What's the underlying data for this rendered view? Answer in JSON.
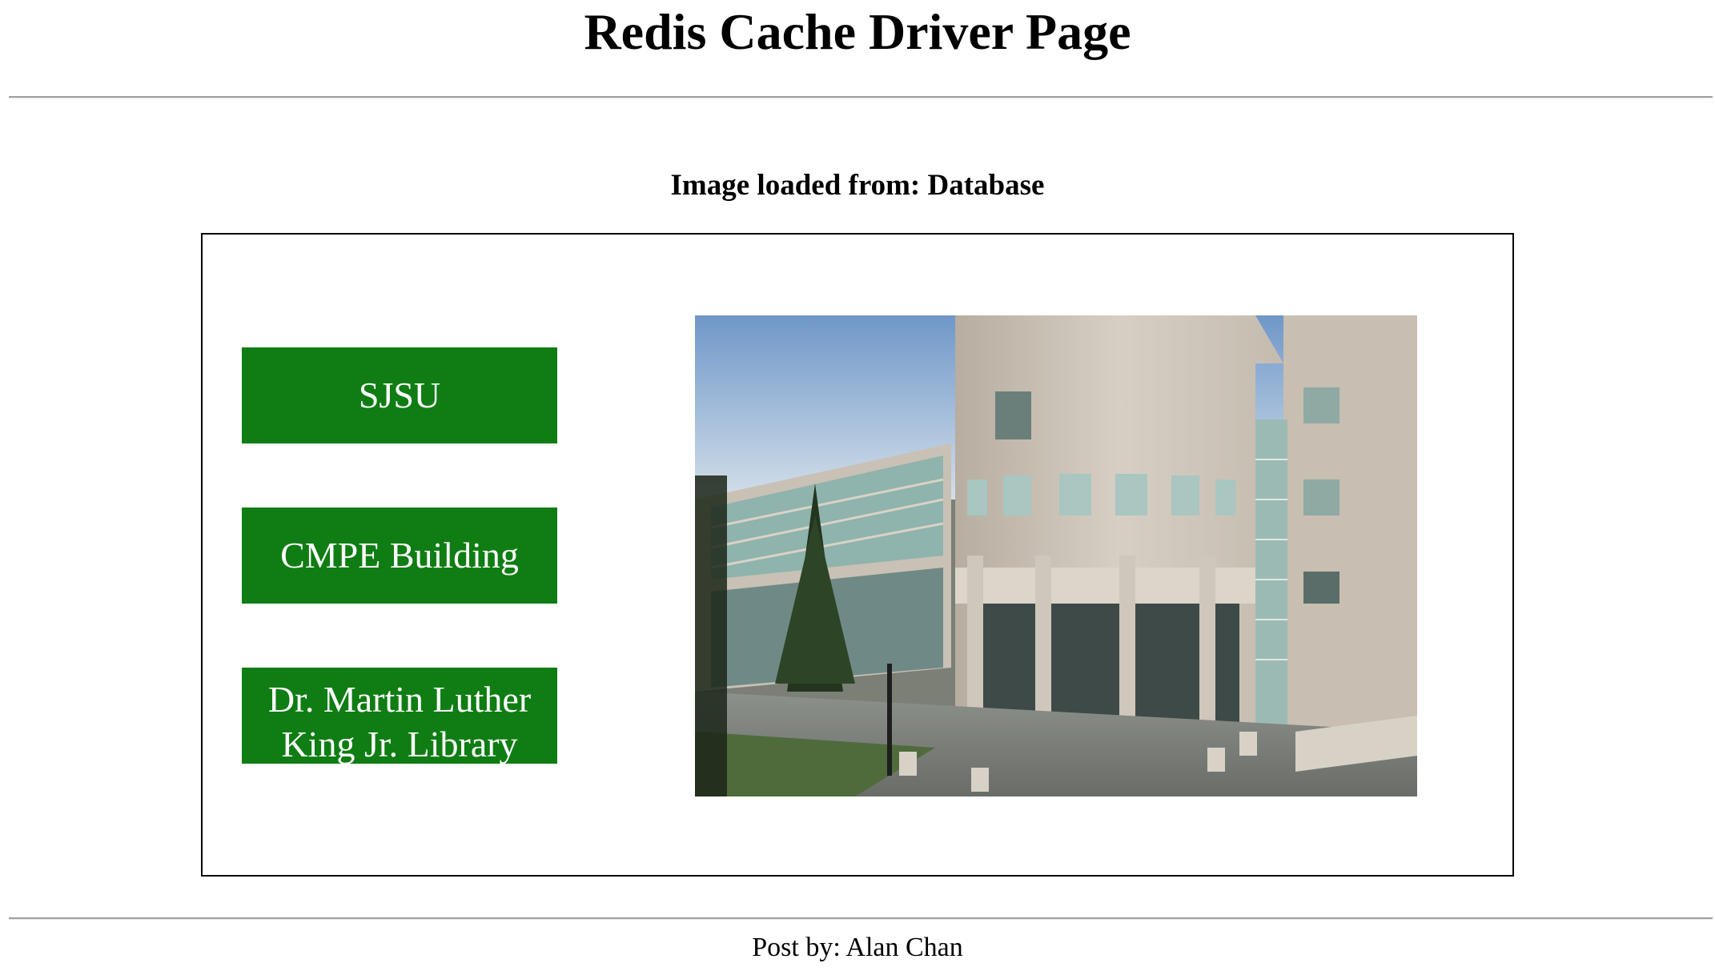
{
  "page": {
    "title": "Redis Cache Driver Page",
    "source_label": "Image loaded from: Database",
    "footer": "Post by: Alan Chan"
  },
  "buttons": [
    {
      "label": "SJSU"
    },
    {
      "label": "CMPE Building"
    },
    {
      "label": "Dr. Martin Luther King Jr. Library"
    }
  ],
  "photo": {
    "subject": "CMPE building photo"
  },
  "colors": {
    "button_bg": "#0f7d13",
    "button_text": "#ffffff"
  }
}
